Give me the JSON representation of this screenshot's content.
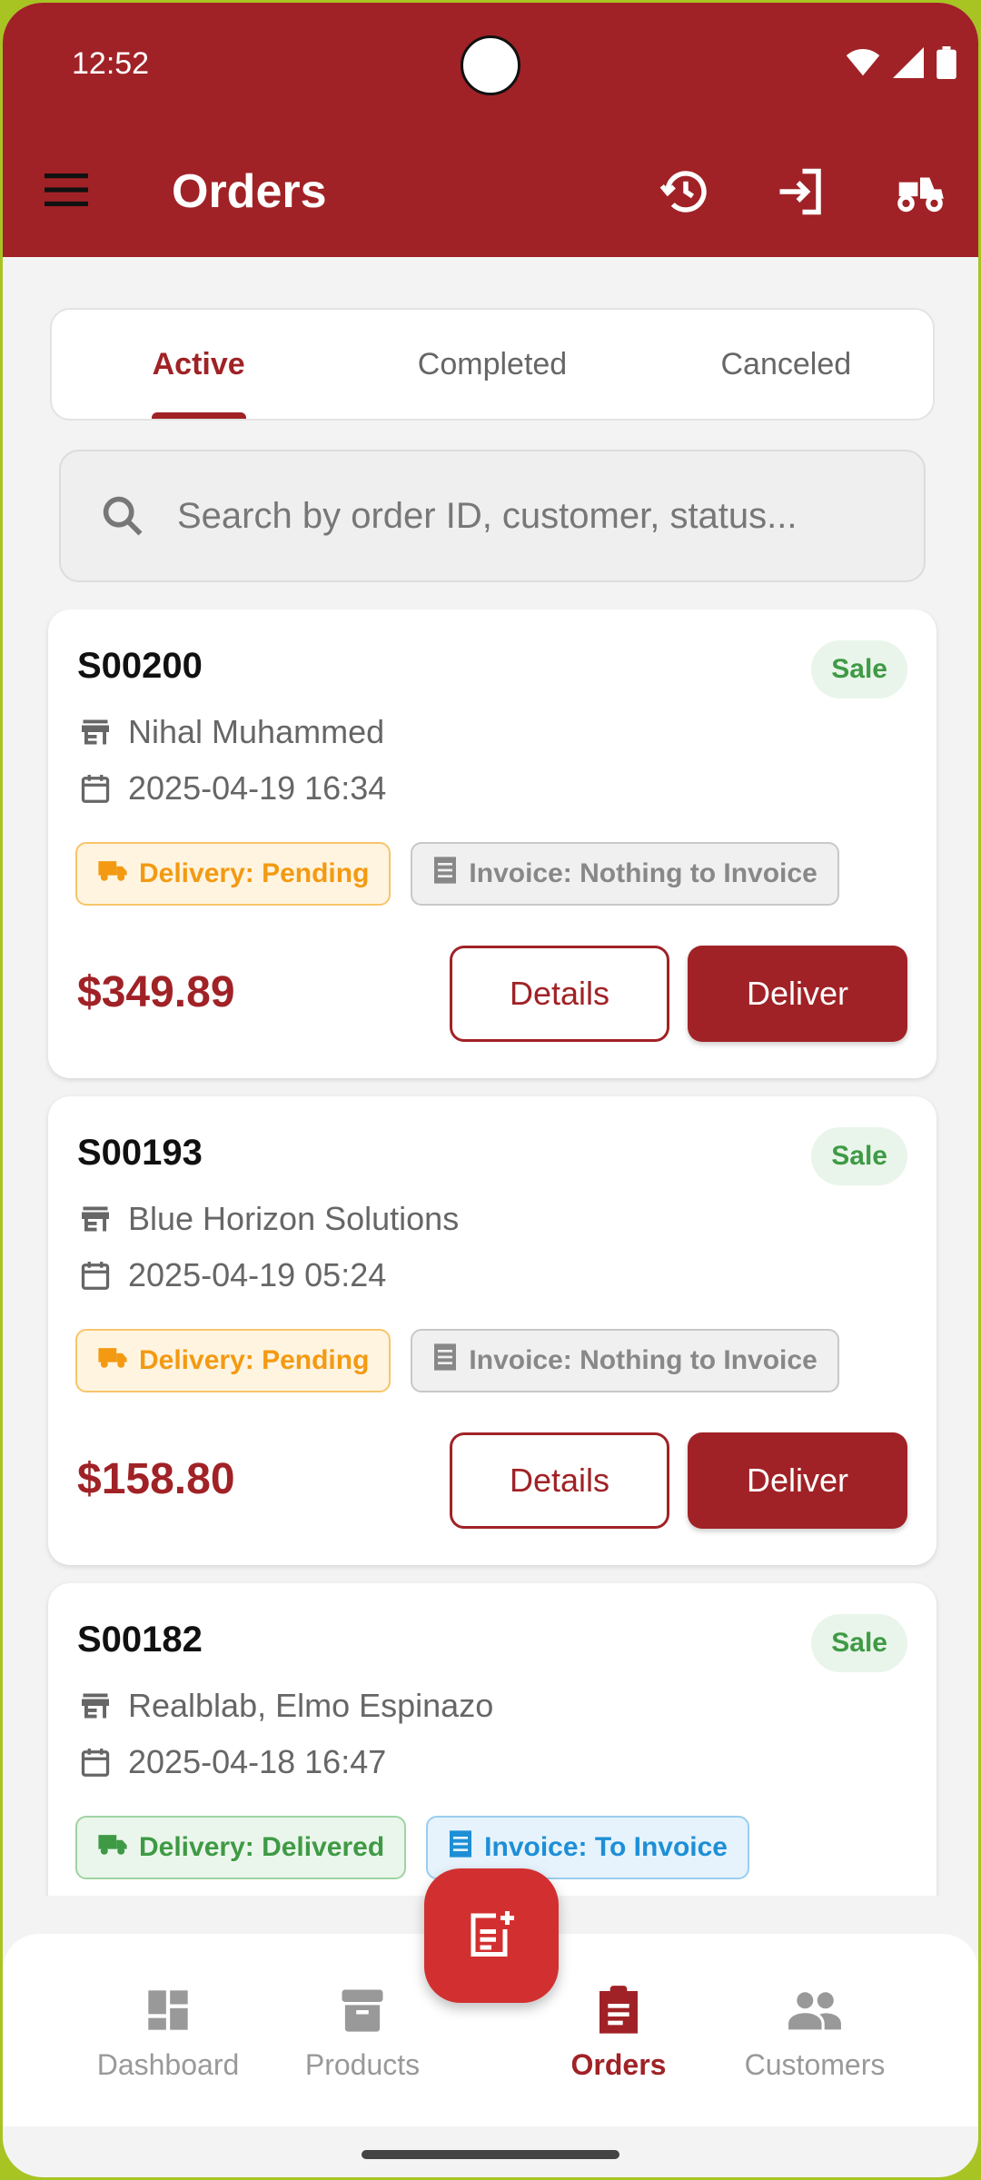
{
  "status_bar": {
    "time": "12:52"
  },
  "header": {
    "title": "Orders",
    "icons": [
      "menu-icon",
      "history-icon",
      "login-icon",
      "delivery-scooter-icon"
    ]
  },
  "tabs": [
    {
      "label": "Active",
      "active": true
    },
    {
      "label": "Completed",
      "active": false
    },
    {
      "label": "Canceled",
      "active": false
    }
  ],
  "search": {
    "placeholder": "Search by order ID, customer, status..."
  },
  "orders": [
    {
      "id": "S00200",
      "type": "Sale",
      "customer": "Nihal Muhammed",
      "datetime": "2025-04-19 16:34",
      "delivery_status": "Delivery: Pending",
      "invoice_status": "Invoice: Nothing to Invoice",
      "total": "$349.89",
      "details_label": "Details",
      "deliver_label": "Deliver"
    },
    {
      "id": "S00193",
      "type": "Sale",
      "customer": "Blue Horizon Solutions",
      "datetime": "2025-04-19 05:24",
      "delivery_status": "Delivery: Pending",
      "invoice_status": "Invoice: Nothing to Invoice",
      "total": "$158.80",
      "details_label": "Details",
      "deliver_label": "Deliver"
    },
    {
      "id": "S00182",
      "type": "Sale",
      "customer": "Realblab, Elmo Espinazo",
      "datetime": "2025-04-18 16:47",
      "delivery_status": "Delivery: Delivered",
      "invoice_status": "Invoice: To Invoice"
    }
  ],
  "bottom_nav": [
    {
      "label": "Dashboard",
      "icon": "dashboard-icon"
    },
    {
      "label": "Products",
      "icon": "archive-box-icon"
    },
    {
      "label": "Orders",
      "icon": "clipboard-icon",
      "active": true
    },
    {
      "label": "Customers",
      "icon": "people-icon"
    }
  ],
  "fab": {
    "icon": "new-order-icon"
  },
  "colors": {
    "primary": "#a02226",
    "fab": "#d23030",
    "background": "#f3f3f3"
  }
}
